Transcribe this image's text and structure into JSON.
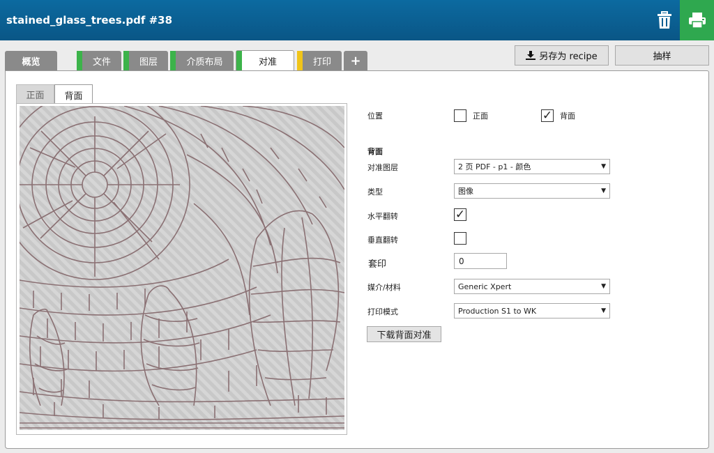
{
  "header": {
    "title": "stained_glass_trees.pdf #38",
    "delete_icon": "trash-icon",
    "print_icon": "printer-icon"
  },
  "tabs": [
    {
      "label": "概览",
      "stripe": ""
    },
    {
      "label": "文件",
      "stripe": "#3cb34a"
    },
    {
      "label": "图层",
      "stripe": "#3cb34a"
    },
    {
      "label": "介质布局",
      "stripe": "#3cb34a"
    },
    {
      "label": "对准",
      "stripe": "#3cb34a",
      "active": true
    },
    {
      "label": "打印",
      "stripe": "#f0c419"
    },
    {
      "label": "+",
      "stripe": ""
    }
  ],
  "toolbar": {
    "save_recipe": "另存为 recipe",
    "sample": "抽样"
  },
  "side_tabs": {
    "front": "正面",
    "back": "背面"
  },
  "form": {
    "position_label": "位置",
    "position_front": "正面",
    "position_back": "背面",
    "position_front_checked": false,
    "position_back_checked": true,
    "section_title": "背面",
    "align_layer_label": "对准图层",
    "align_layer_value": "2 页 PDF - p1 - 颜色",
    "type_label": "类型",
    "type_value": "图像",
    "h_flip_label": "水平翻转",
    "h_flip_checked": true,
    "v_flip_label": "垂直翻转",
    "v_flip_checked": false,
    "registration_label": "套印",
    "registration_value": "0",
    "media_label": "媒介/材料",
    "media_value": "Generic Xpert",
    "print_mode_label": "打印模式",
    "print_mode_value": "Production S1 to WK",
    "download_button": "下载背面对准"
  },
  "colors": {
    "header": "#0a5e92",
    "print_button": "#2fa84f",
    "tab_inactive": "#8a8a8a",
    "stripe_green": "#3cb34a",
    "stripe_yellow": "#f0c419"
  }
}
